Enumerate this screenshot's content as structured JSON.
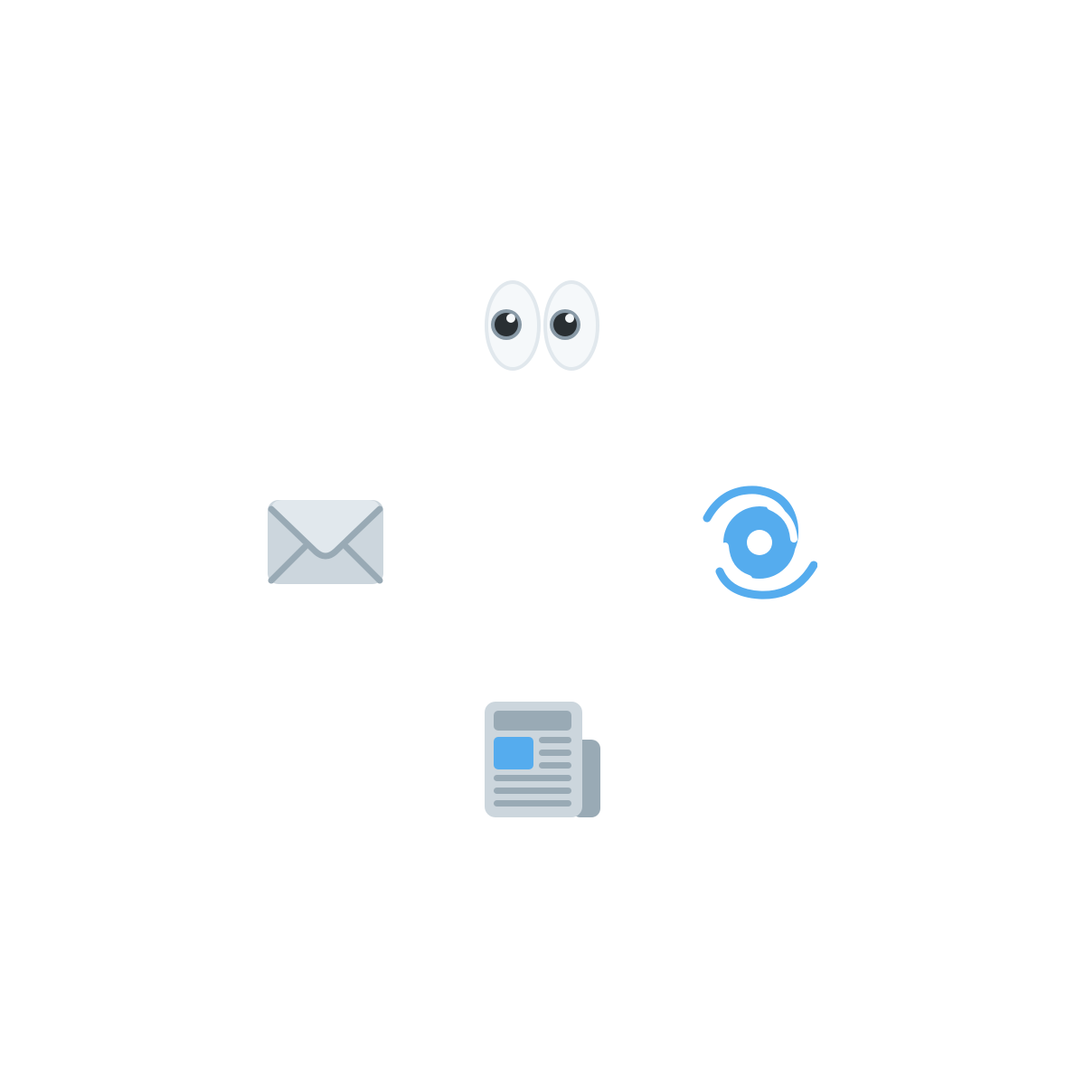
{
  "icons": [
    {
      "name": "eyes-icon"
    },
    {
      "name": "envelope-icon"
    },
    {
      "name": "cyclone-icon"
    },
    {
      "name": "newspaper-icon"
    }
  ],
  "colors": {
    "background": "#ffffff",
    "eye_white": "#f5f8fa",
    "eye_outline": "#e1e8ed",
    "pupil_ring": "#8899a6",
    "pupil": "#292f33",
    "envelope_body": "#ccd6dd",
    "envelope_flap": "#e1e8ed",
    "envelope_lines": "#99aab5",
    "cyclone": "#55acee",
    "newspaper_page": "#ccd6dd",
    "newspaper_back": "#99aab5",
    "newspaper_lines": "#99aab5",
    "newspaper_photo": "#55acee"
  }
}
